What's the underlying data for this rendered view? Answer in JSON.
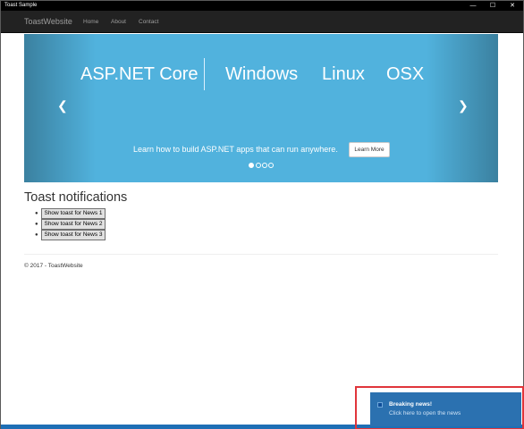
{
  "window": {
    "title": "Toast Sample",
    "minimize_glyph": "—",
    "maximize_glyph": "☐",
    "close_glyph": "✕"
  },
  "navbar": {
    "brand": "ToastWebsite",
    "items": [
      {
        "label": "Home"
      },
      {
        "label": "About"
      },
      {
        "label": "Contact"
      }
    ]
  },
  "carousel": {
    "hero_items": [
      "ASP.NET Core",
      "Windows",
      "Linux",
      "OSX"
    ],
    "caption": "Learn how to build ASP.NET apps that can run anywhere.",
    "button_label": "Learn More",
    "prev_glyph": "❮",
    "next_glyph": "❯",
    "slide_count": 4,
    "active_slide": 1,
    "background_color": "#51b2dd"
  },
  "main": {
    "heading": "Toast notifications",
    "buttons": [
      {
        "label": "Show toast for News 1"
      },
      {
        "label": "Show toast for News 2"
      },
      {
        "label": "Show toast for News 3"
      }
    ]
  },
  "footer": {
    "text": "© 2017 - ToastWebsite"
  },
  "toast": {
    "title": "Breaking news!",
    "body": "Click here to open the news",
    "background_color": "#2b71b0",
    "highlight_color": "#e0353b"
  }
}
